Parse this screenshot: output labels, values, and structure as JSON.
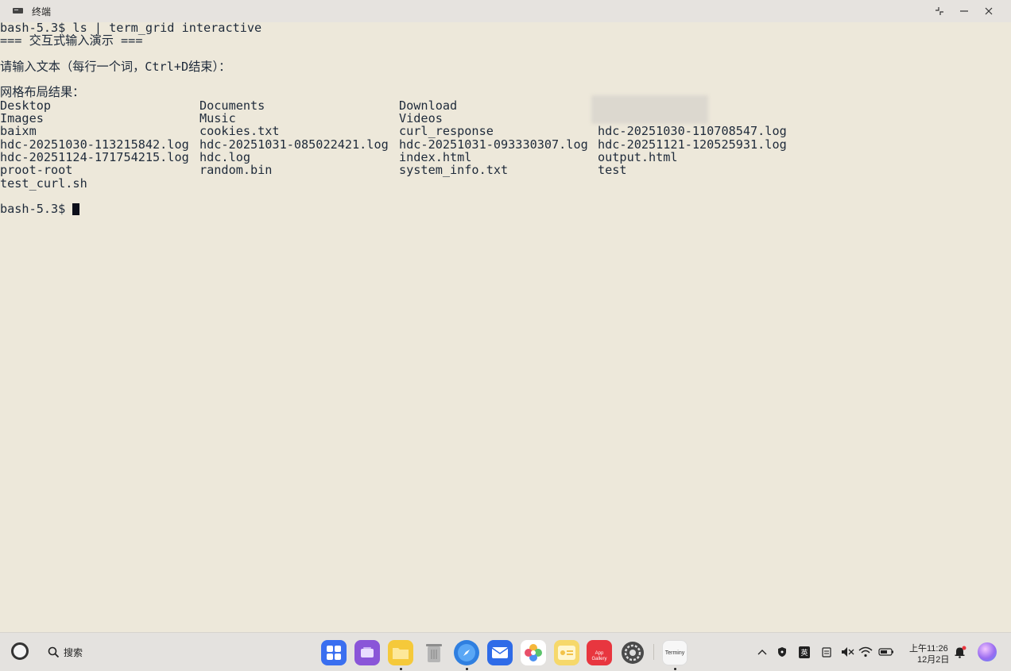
{
  "window": {
    "title": "终端"
  },
  "terminal": {
    "command_line": "bash-5.3$ ls | term_grid interactive",
    "banner": "=== 交互式输入演示 ===",
    "input_prompt": "请输入文本（每行一个词，Ctrl+D结束）：",
    "result_header": "网格布局结果：",
    "grid": [
      [
        "Desktop",
        "Documents",
        "Download",
        ""
      ],
      [
        "Images",
        "Music",
        "Videos",
        ""
      ],
      [
        "baixm",
        "cookies.txt",
        "curl_response",
        "hdc-20251030-110708547.log"
      ],
      [
        "hdc-20251030-113215842.log",
        "hdc-20251031-085022421.log",
        "hdc-20251031-093330307.log",
        "hdc-20251121-120525931.log"
      ],
      [
        "hdc-20251124-171754215.log",
        "hdc.log",
        "index.html",
        "output.html"
      ],
      [
        "proot-root",
        "random.bin",
        "system_info.txt",
        "test"
      ],
      [
        "test_curl.sh",
        "",
        "",
        ""
      ]
    ],
    "final_prompt": "bash-5.3$ "
  },
  "taskbar": {
    "search_label": "搜索",
    "apps": [
      {
        "name": "app-grid-icon",
        "color": "#3a6ff0"
      },
      {
        "name": "multitask-icon",
        "color": "#8a55d8"
      },
      {
        "name": "files-icon",
        "color": "#f5c93a"
      },
      {
        "name": "recycle-bin-icon",
        "color": "#9a9a9a"
      },
      {
        "name": "browser-icon",
        "color": "#2f7fe0"
      },
      {
        "name": "mail-icon",
        "color": "#2e6be8"
      },
      {
        "name": "photos-icon",
        "color": "#f08a3a"
      },
      {
        "name": "notes-icon",
        "color": "#f6d86a"
      },
      {
        "name": "app-gallery-icon",
        "color": "#e8363f"
      },
      {
        "name": "settings-icon",
        "color": "#555555"
      },
      {
        "name": "terminal-app-icon",
        "color": "#f4f4f4"
      }
    ],
    "app_gallery_label": "App Gallery",
    "terminal_app_label": "Terminy",
    "ime_label": "英",
    "clock_time": "上午11:26",
    "clock_date": "12月2日"
  }
}
